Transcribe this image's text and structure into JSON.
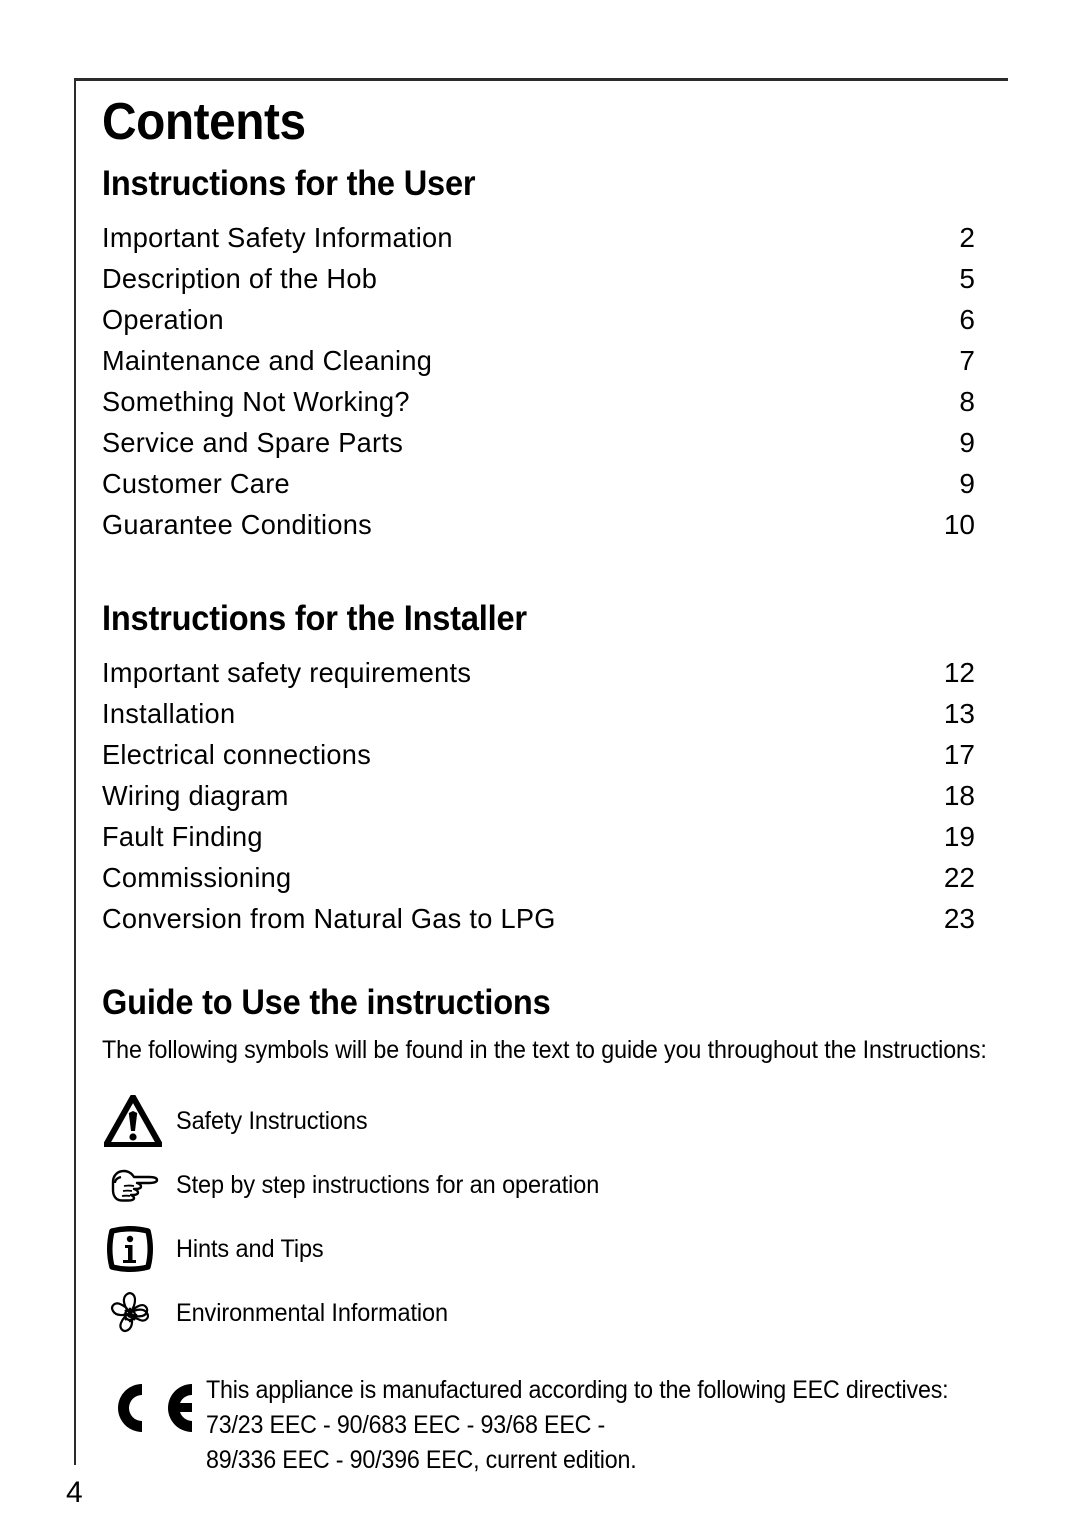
{
  "page": {
    "title": "Contents",
    "footer_page_number": "4"
  },
  "sections": [
    {
      "id": "user",
      "heading": "Instructions for the User",
      "entries": [
        {
          "label": "Important Safety Information",
          "page": "2"
        },
        {
          "label": "Description of the Hob",
          "page": "5"
        },
        {
          "label": "Operation",
          "page": "6"
        },
        {
          "label": "Maintenance and Cleaning",
          "page": "7"
        },
        {
          "label": "Something Not Working?",
          "page": "8"
        },
        {
          "label": "Service and Spare Parts",
          "page": "9"
        },
        {
          "label": "Customer Care",
          "page": "9"
        },
        {
          "label": "Guarantee Conditions",
          "page": "10"
        }
      ]
    },
    {
      "id": "installer",
      "heading": "Instructions for the Installer",
      "entries": [
        {
          "label": "Important safety requirements",
          "page": "12"
        },
        {
          "label": "Installation",
          "page": "13"
        },
        {
          "label": "Electrical connections",
          "page": "17"
        },
        {
          "label": "Wiring diagram",
          "page": "18"
        },
        {
          "label": "Fault Finding",
          "page": "19"
        },
        {
          "label": "Commissioning",
          "page": "22"
        },
        {
          "label": "Conversion from Natural Gas to LPG",
          "page": "23"
        }
      ]
    }
  ],
  "guide": {
    "heading": "Guide to Use the instructions",
    "intro": "The following symbols will be found in the text to guide you throughout the Instructions:",
    "symbols": [
      {
        "icon": "warning-triangle-icon",
        "label": "Safety Instructions"
      },
      {
        "icon": "pointing-hand-icon",
        "label": "Step by step instructions for an  operation"
      },
      {
        "icon": "info-icon",
        "label": "Hints and Tips"
      },
      {
        "icon": "environment-flower-icon",
        "label": "Environmental Information"
      }
    ]
  },
  "ce_notice": {
    "mark": "ce-mark-icon",
    "lines": [
      "This appliance is manufactured according to the following EEC directives:",
      "73/23 EEC - 90/683 EEC - 93/68 EEC -",
      "89/336 EEC - 90/396 EEC, current edition."
    ]
  },
  "colors": {
    "ink": "#000000",
    "rule": "#2b2b2b",
    "paper": "#ffffff"
  }
}
